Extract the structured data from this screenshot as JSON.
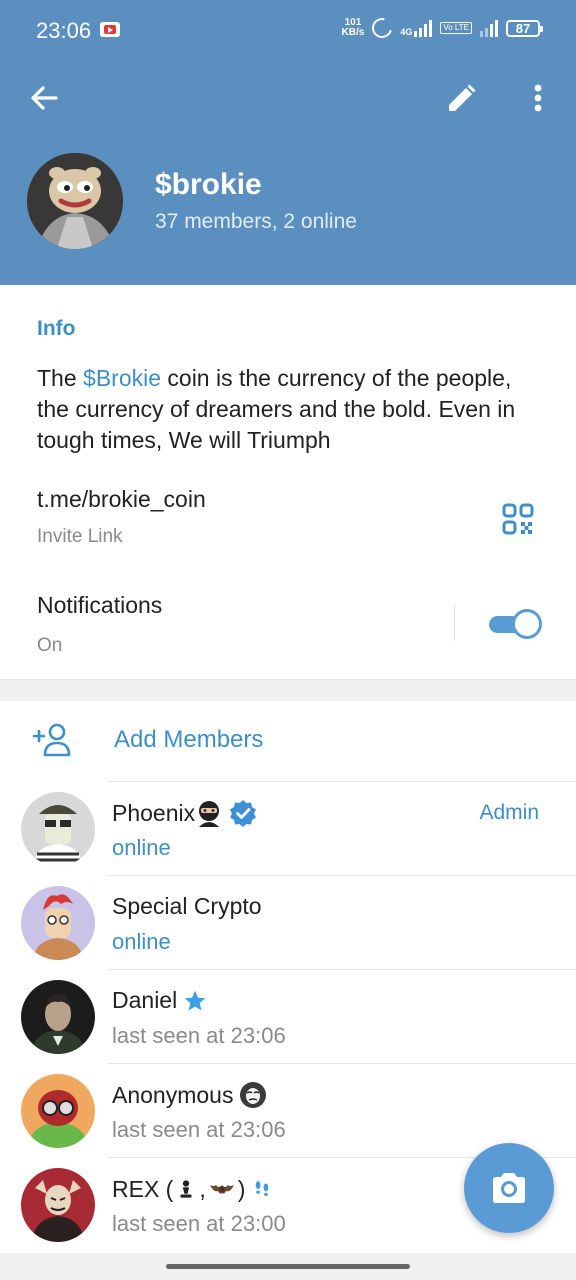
{
  "status_bar": {
    "time": "23:06",
    "net_speed_value": "101",
    "net_speed_unit": "KB/s",
    "network_tag": "4G",
    "volte": "Vo LTE",
    "battery": "87"
  },
  "header": {
    "title": "$brokie",
    "subtitle": "37 members, 2 online",
    "accent_color": "#5b8fbf"
  },
  "info": {
    "section_title": "Info",
    "description_before": "The ",
    "description_highlight": "$Brokie",
    "description_after": " coin is the currency of the people, the currency of dreamers and the bold. Even in tough times, We will Triumph",
    "link": "t.me/brokie_coin",
    "link_sub": "Invite Link",
    "notifications_label": "Notifications",
    "notifications_state": "On"
  },
  "members": {
    "add_label": "Add Members",
    "list": [
      {
        "name": "Phoenix",
        "status": "online",
        "role": "Admin"
      },
      {
        "name": "Special Crypto",
        "status": "online",
        "role": ""
      },
      {
        "name": "Daniel",
        "status": "last seen at 23:06",
        "role": ""
      },
      {
        "name": "Anonymous",
        "status": "last seen at 23:06",
        "role": ""
      },
      {
        "name": "REX (",
        "name_mid": ",",
        "name_end": ")",
        "status": "last seen at 23:00",
        "role": ""
      }
    ]
  },
  "icons": {
    "back": "arrow-left-icon",
    "edit": "pencil-icon",
    "more": "more-vertical-icon",
    "qr": "qr-code-icon",
    "add_member": "add-person-icon",
    "camera": "camera-icon"
  }
}
